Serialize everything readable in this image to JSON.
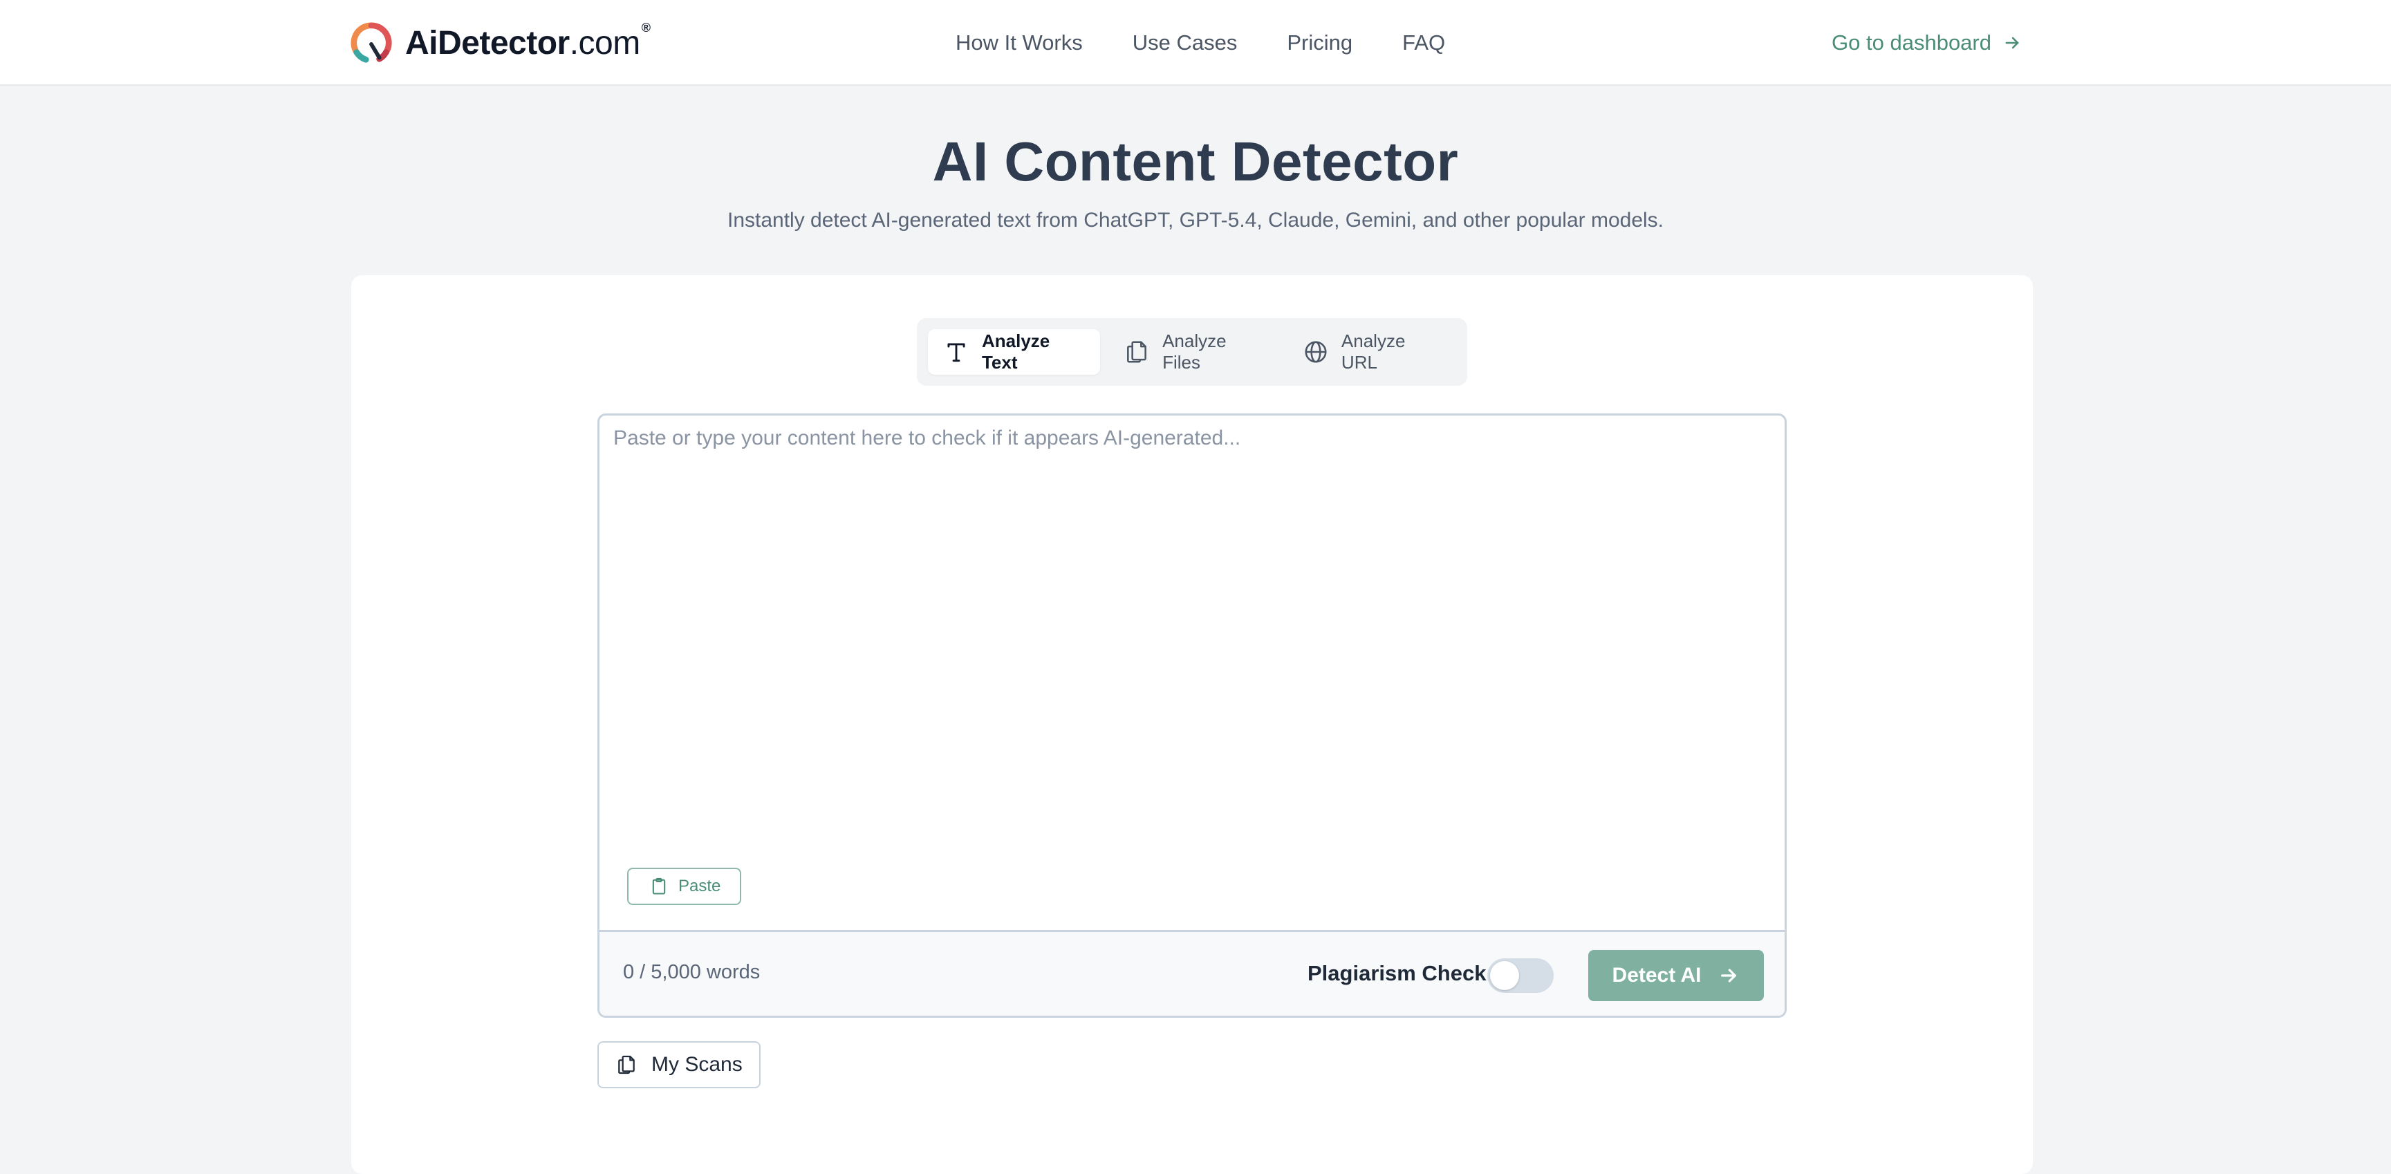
{
  "header": {
    "logo": {
      "brand": "AiDetector",
      "suffix": ".com",
      "reg": "®"
    },
    "nav": [
      {
        "label": "How It Works"
      },
      {
        "label": "Use Cases"
      },
      {
        "label": "Pricing"
      },
      {
        "label": "FAQ"
      }
    ],
    "dashboard_link": "Go to dashboard"
  },
  "hero": {
    "title": "AI Content Detector",
    "subtitle": "Instantly detect AI-generated text from ChatGPT, GPT-5.4, Claude, Gemini, and other popular models."
  },
  "tabs": [
    {
      "label": "Analyze Text",
      "icon": "text-icon",
      "active": true
    },
    {
      "label": "Analyze Files",
      "icon": "files-icon",
      "active": false
    },
    {
      "label": "Analyze URL",
      "icon": "globe-icon",
      "active": false
    }
  ],
  "editor": {
    "placeholder": "Paste or type your content here to check if it appears AI-generated...",
    "value": "",
    "paste_label": "Paste",
    "word_count": "0 / 5,000 words",
    "plagiarism_label": "Plagiarism Check",
    "plagiarism_enabled": false,
    "detect_label": "Detect AI"
  },
  "my_scans_label": "My Scans",
  "colors": {
    "accent": "#4a8d77",
    "button_disabled": "#7fb0a0",
    "title": "#2f3b4f",
    "page_bg": "#f3f4f6"
  }
}
